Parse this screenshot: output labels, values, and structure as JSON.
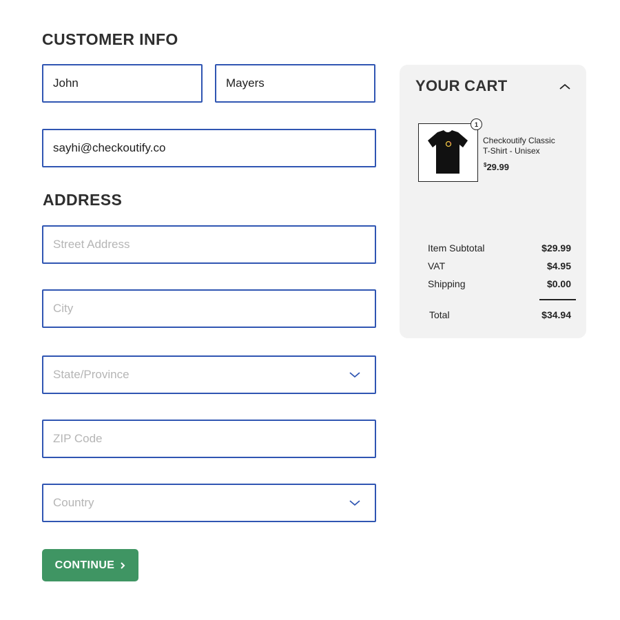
{
  "customer": {
    "title": "CUSTOMER INFO",
    "first_name": "John",
    "last_name": "Mayers",
    "email": "sayhi@checkoutify.co"
  },
  "address": {
    "title": "ADDRESS",
    "street_placeholder": "Street Address",
    "city_placeholder": "City",
    "state_placeholder": "State/Province",
    "zip_placeholder": "ZIP Code",
    "country_placeholder": "Country"
  },
  "continue_label": "CONTINUE",
  "cart": {
    "title": "YOUR CART",
    "item": {
      "name_line1": "Checkoutify Classic",
      "name_line2": "T-Shirt - Unisex",
      "currency": "$",
      "price": "29.99",
      "quantity": "1"
    },
    "summary": [
      {
        "label": "Item Subtotal",
        "amount": "$29.99"
      },
      {
        "label": "VAT",
        "amount": "$4.95"
      },
      {
        "label": "Shipping",
        "amount": "$0.00"
      }
    ],
    "total_label": "Total",
    "total_amount": "$34.94"
  },
  "colors": {
    "field_border": "#2f55b2",
    "button": "#3f9563",
    "cart_bg": "#f2f2f2"
  },
  "icons": {
    "select_chevron": "chevron-down-icon",
    "cart_toggle": "chevron-up-icon",
    "button_arrow": "chevron-right-icon",
    "product": "tshirt-icon"
  }
}
